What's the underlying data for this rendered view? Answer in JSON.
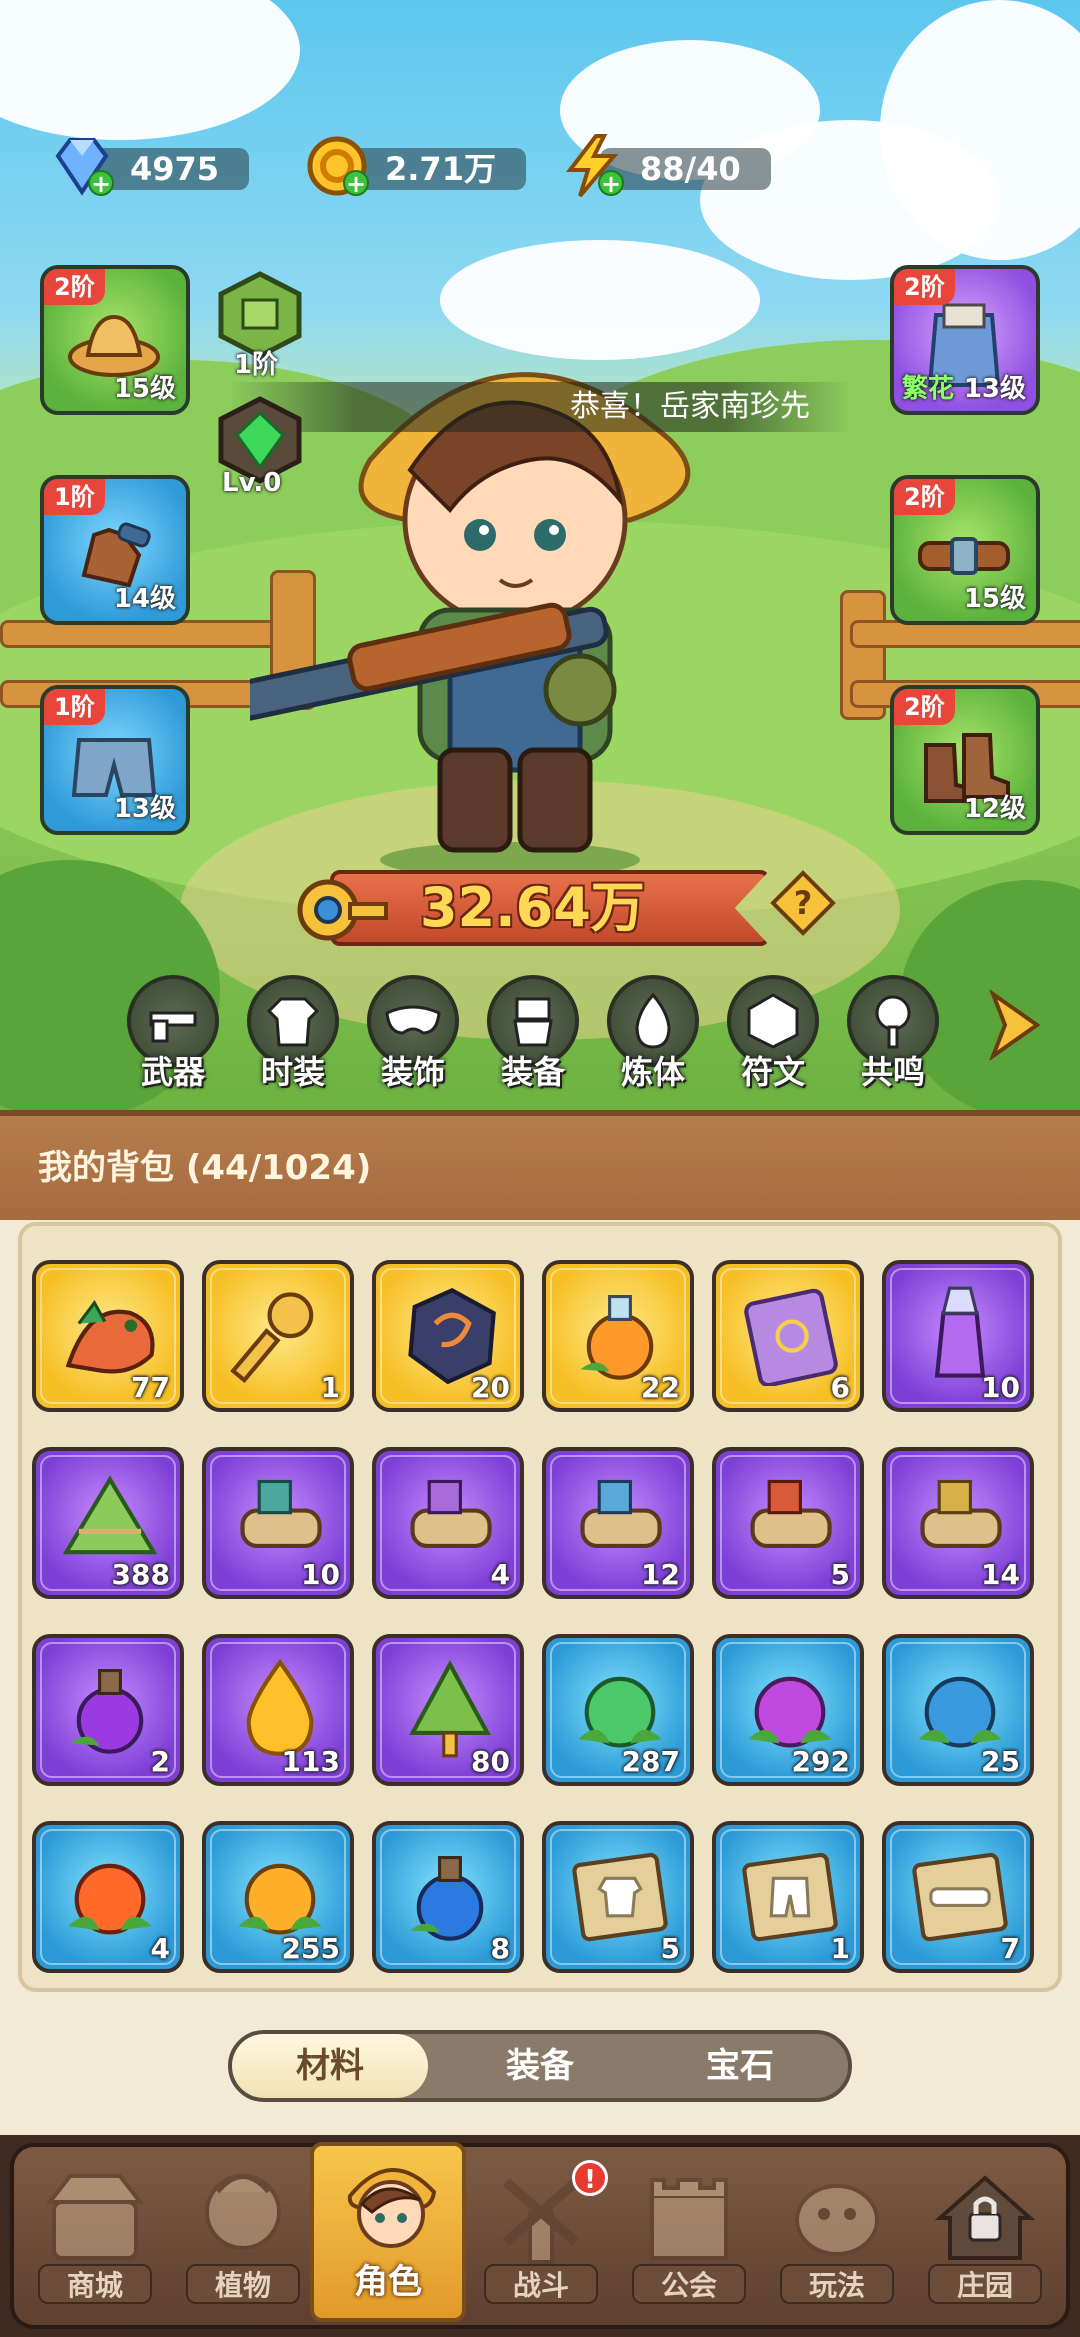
{
  "resources": {
    "gems": "4975",
    "gold": "2.71万",
    "energy": "88/40"
  },
  "ticker": "恭喜！岳家南珍先",
  "slots": {
    "hat": {
      "tier": "2阶",
      "level": "15级"
    },
    "gloves": {
      "tier": "1阶",
      "level": "14级"
    },
    "pants": {
      "tier": "1阶",
      "level": "13级"
    },
    "outfit": {
      "tier": "2阶",
      "name": "繁花",
      "level": "13级"
    },
    "belt": {
      "tier": "2阶",
      "level": "15级"
    },
    "boots": {
      "tier": "2阶",
      "level": "12级"
    }
  },
  "badges": {
    "rank_label": "1阶",
    "gem_label": "Lv.0"
  },
  "power": "32.64万",
  "functions": [
    "武器",
    "时装",
    "装饰",
    "装备",
    "炼体",
    "符文",
    "共鸣"
  ],
  "bag": {
    "title": "我的背包 (44/1024)",
    "items": [
      {
        "rarity": "gold",
        "icon": "dragon-icon",
        "count": "77"
      },
      {
        "rarity": "gold",
        "icon": "key-icon",
        "count": "1"
      },
      {
        "rarity": "gold",
        "icon": "rune-stone-icon",
        "count": "20"
      },
      {
        "rarity": "gold",
        "icon": "orange-potion-icon",
        "count": "22"
      },
      {
        "rarity": "gold",
        "icon": "spell-book-icon",
        "count": "6"
      },
      {
        "rarity": "purple",
        "icon": "purple-vial-icon",
        "count": "10"
      },
      {
        "rarity": "purple",
        "icon": "rice-dumpling-icon",
        "count": "388"
      },
      {
        "rarity": "purple",
        "icon": "green-scroll-icon",
        "count": "10"
      },
      {
        "rarity": "purple",
        "icon": "purple-scroll-icon",
        "count": "4"
      },
      {
        "rarity": "purple",
        "icon": "blue-scroll-icon",
        "count": "12"
      },
      {
        "rarity": "purple",
        "icon": "red-scroll-icon",
        "count": "5"
      },
      {
        "rarity": "purple",
        "icon": "gold-scroll-icon",
        "count": "14"
      },
      {
        "rarity": "purple",
        "icon": "purple-flask-icon",
        "count": "2"
      },
      {
        "rarity": "purple",
        "icon": "golden-drop-icon",
        "count": "113"
      },
      {
        "rarity": "purple",
        "icon": "sachet-icon",
        "count": "80"
      },
      {
        "rarity": "blue",
        "icon": "green-seed-icon",
        "count": "287"
      },
      {
        "rarity": "blue",
        "icon": "purple-seed-icon",
        "count": "292"
      },
      {
        "rarity": "blue",
        "icon": "blue-seed-icon",
        "count": "25"
      },
      {
        "rarity": "blue",
        "icon": "fire-seed-icon",
        "count": "4"
      },
      {
        "rarity": "blue",
        "icon": "lightning-seed-icon",
        "count": "255"
      },
      {
        "rarity": "blue",
        "icon": "blue-flask-icon",
        "count": "8"
      },
      {
        "rarity": "blue",
        "icon": "outfit-blueprint-icon",
        "count": "5"
      },
      {
        "rarity": "blue",
        "icon": "pants-blueprint-icon",
        "count": "1"
      },
      {
        "rarity": "blue",
        "icon": "belt-blueprint-icon",
        "count": "7"
      }
    ]
  },
  "tabs": [
    "材料",
    "装备",
    "宝石"
  ],
  "nav": [
    "商城",
    "植物",
    "角色",
    "战斗",
    "公会",
    "玩法",
    "庄园"
  ],
  "nav_alert": "!",
  "colors": {
    "gold_rarity": "#f6bf25",
    "purple_rarity": "#7e3fd6",
    "blue_rarity": "#2b9ad6",
    "tier_badge": "#e8453b",
    "bag_header": "#a56b3e"
  }
}
